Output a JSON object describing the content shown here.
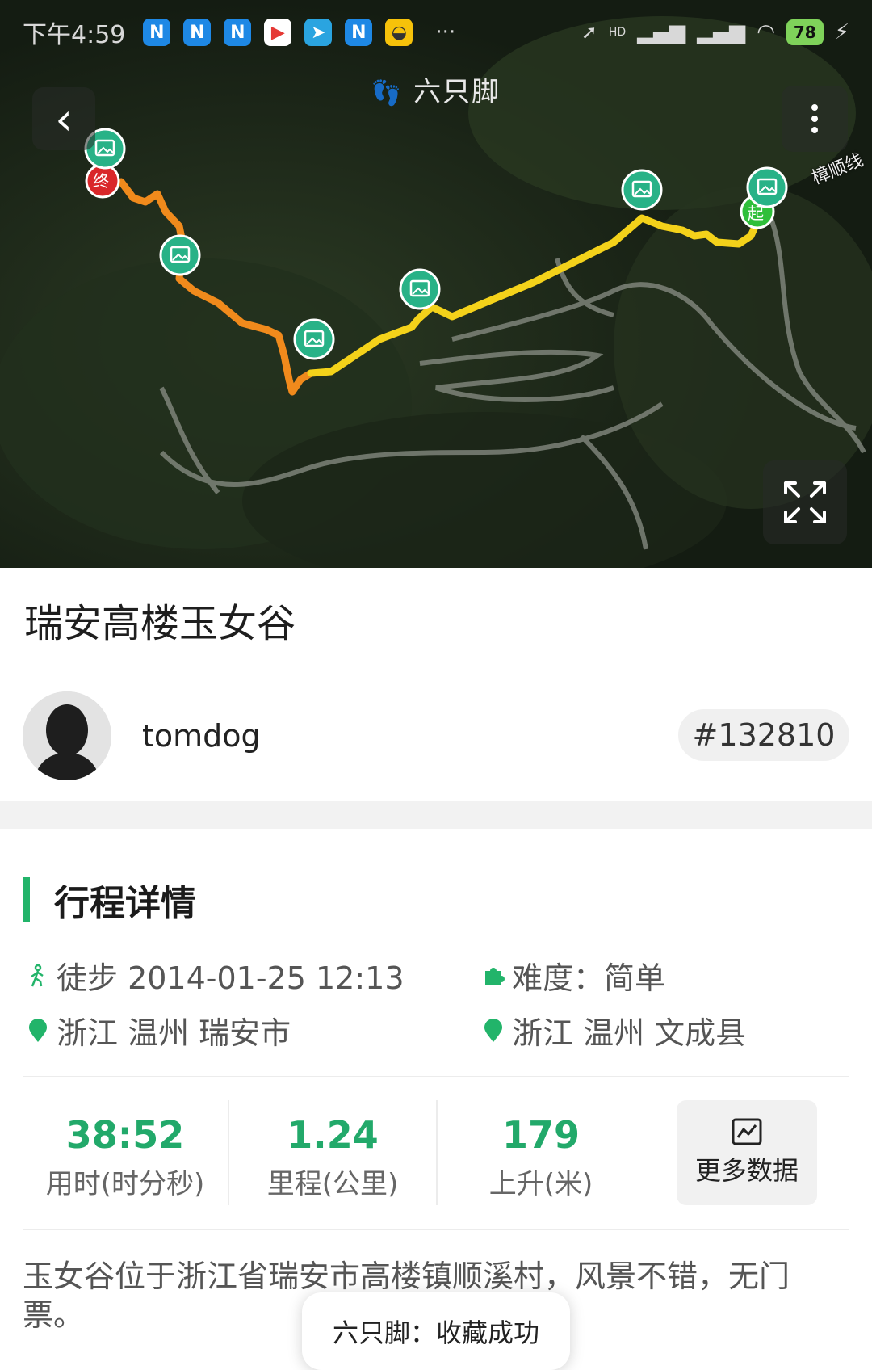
{
  "status_bar": {
    "time": "下午4:59",
    "battery": "78",
    "hd_label": "HD"
  },
  "map": {
    "brand": "六只脚",
    "road_label": "樟顺线",
    "start_marker": "起",
    "end_marker": "终"
  },
  "trip": {
    "title": "瑞安高楼玉女谷",
    "author": "tomdog",
    "route_id": "#132810"
  },
  "details": {
    "section_title": "行程详情",
    "activity": "徒步 2014-01-25 12:13",
    "difficulty": "难度：简单",
    "start_location": "浙江 温州 瑞安市",
    "end_location": "浙江 温州 文成县"
  },
  "stats": [
    {
      "value": "38:52",
      "label": "用时(时分秒)"
    },
    {
      "value": "1.24",
      "label": "里程(公里)"
    },
    {
      "value": "179",
      "label": "上升(米)"
    }
  ],
  "more_data_label": "更多数据",
  "description": "玉女谷位于浙江省瑞安市高楼镇顺溪村，风景不错，无门票。",
  "toast": "六只脚：收藏成功",
  "colors": {
    "accent_green": "#22b46a",
    "track_yellow": "#f4d21a",
    "track_orange": "#f08a1c",
    "start_green": "#2fbf3a",
    "end_red": "#d9272a"
  }
}
